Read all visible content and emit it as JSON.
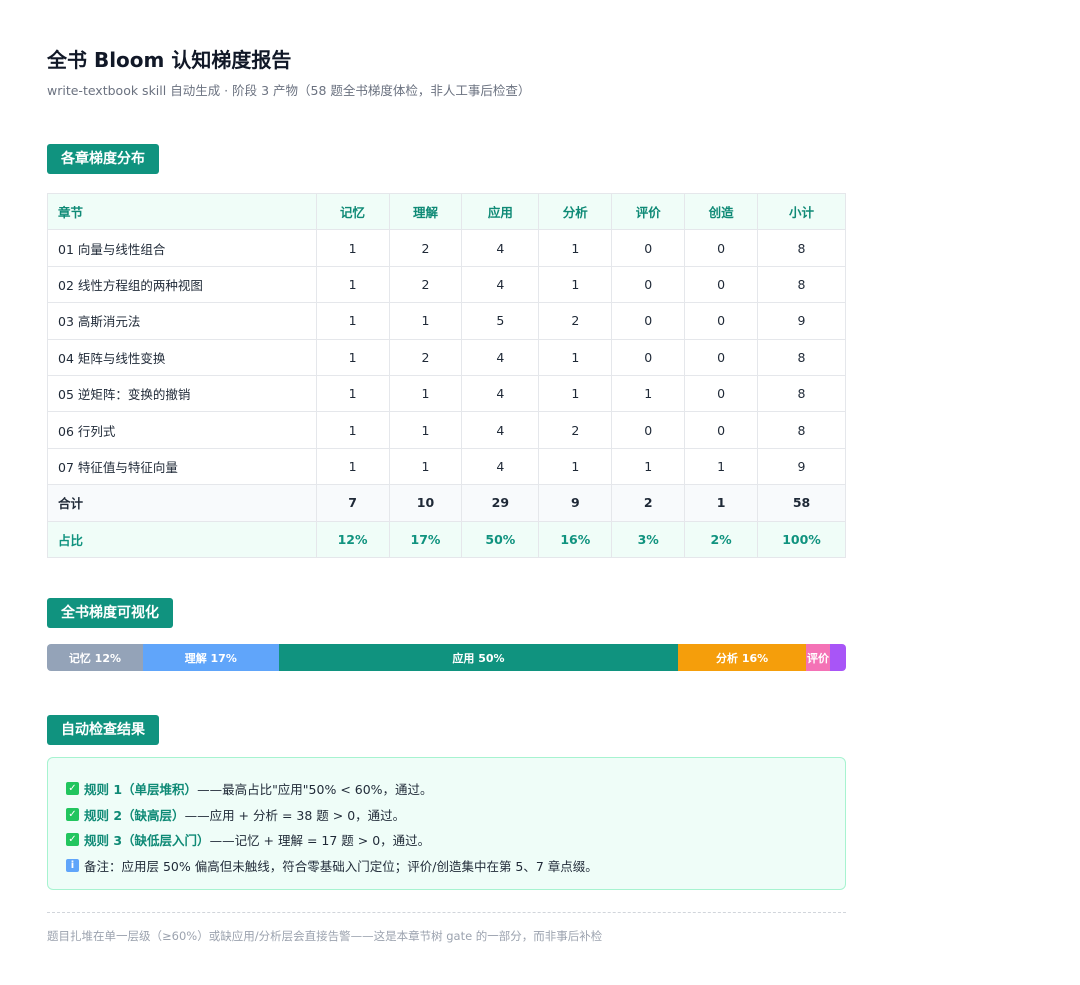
{
  "header": {
    "title": "全书 Bloom 认知梯度报告",
    "subtitle": "write-textbook skill 自动生成 · 阶段 3 产物（58 题全书梯度体检，非人工事后检查）"
  },
  "sections": {
    "distribution": "各章梯度分布",
    "visual": "全书梯度可视化",
    "check": "自动检查结果"
  },
  "table": {
    "headers": [
      "章节",
      "记忆",
      "理解",
      "应用",
      "分析",
      "评价",
      "创造",
      "小计"
    ],
    "rows": [
      [
        "01 向量与线性组合",
        "1",
        "2",
        "4",
        "1",
        "0",
        "0",
        "8"
      ],
      [
        "02 线性方程组的两种视图",
        "1",
        "2",
        "4",
        "1",
        "0",
        "0",
        "8"
      ],
      [
        "03 高斯消元法",
        "1",
        "1",
        "5",
        "2",
        "0",
        "0",
        "9"
      ],
      [
        "04 矩阵与线性变换",
        "1",
        "2",
        "4",
        "1",
        "0",
        "0",
        "8"
      ],
      [
        "05 逆矩阵：变换的撤销",
        "1",
        "1",
        "4",
        "1",
        "1",
        "0",
        "8"
      ],
      [
        "06 行列式",
        "1",
        "1",
        "4",
        "2",
        "0",
        "0",
        "8"
      ],
      [
        "07 特征值与特征向量",
        "1",
        "1",
        "4",
        "1",
        "1",
        "1",
        "9"
      ]
    ],
    "total": [
      "合计",
      "7",
      "10",
      "29",
      "9",
      "2",
      "1",
      "58"
    ],
    "ratio": [
      "占比",
      "12%",
      "17%",
      "50%",
      "16%",
      "3%",
      "2%",
      "100%"
    ]
  },
  "gradient_bar": [
    {
      "label": "记忆 12%",
      "percent": 12,
      "color": "#94a3b8"
    },
    {
      "label": "理解 17%",
      "percent": 17,
      "color": "#60a5fa"
    },
    {
      "label": "应用 50%",
      "percent": 50,
      "color": "#10937f"
    },
    {
      "label": "分析 16%",
      "percent": 16,
      "color": "#f59e0b"
    },
    {
      "label": "评价",
      "percent": 3,
      "color": "#f472b6"
    },
    {
      "label": "",
      "percent": 2,
      "color": "#a855f7"
    }
  ],
  "checks": [
    {
      "icon": "check-icon",
      "name": "规则 1（单层堆积）",
      "text": "——最高占比\"应用\"50% < 60%，通过。"
    },
    {
      "icon": "check-icon",
      "name": "规则 2（缺高层）",
      "text": "——应用 + 分析 = 38 题 > 0，通过。"
    },
    {
      "icon": "check-icon",
      "name": "规则 3（缺低层入门）",
      "text": "——记忆 + 理解 = 17 题 > 0，通过。"
    },
    {
      "icon": "info-icon",
      "name": "",
      "text": "备注：应用层 50% 偏高但未触线，符合零基础入门定位；评价/创造集中在第 5、7 章点缀。"
    }
  ],
  "footnote": "题目扎堆在单一层级（≥60%）或缺应用/分析层会直接告警——这是本章节树 gate 的一部分，而非事后补检"
}
